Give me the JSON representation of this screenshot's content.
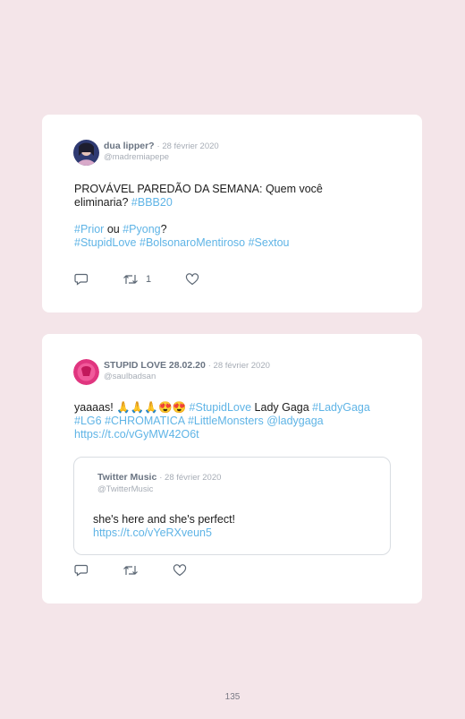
{
  "tweets": [
    {
      "author": "dua lipper?",
      "date": "· 28 février 2020",
      "handle": "@madremiapepe",
      "text_line1": "PROVÁVEL PAREDÃO DA SEMANA: Quem você",
      "text_line2_plain": "eliminaria? ",
      "tag_bbb": "#BBB20",
      "tag_prior": "#Prior",
      "word_ou": " ou ",
      "tag_pyong": "#Pyong",
      "question_mark": "?",
      "tag_stupidlove": "#StupidLove",
      "tag_bolsonaro": "#BolsonaroMentiroso",
      "tag_sextou": "#Sextou",
      "retweet_count": "1"
    },
    {
      "author": "STUPID LOVE 28.02.20",
      "date": "· 28 février 2020",
      "handle": "@saulbadsan",
      "text_start": "yaaaas! 🙏🙏🙏😍😍 ",
      "tag_stupidlove": "#StupidLove",
      "text_mid": " Lady Gaga ",
      "tag_ladygaga": "#LadyGaga",
      "tag_lg6": "#LG6",
      "tag_chromatica": "#CHROMATICA",
      "tag_littlemonsters": "#LittleMonsters",
      "mention_ladygaga": "@ladygaga",
      "link": "https://t.co/vGyMW42O6t",
      "quote": {
        "author": "Twitter Music",
        "date": "· 28 février 2020",
        "handle": "@TwitterMusic",
        "text": "she's here and she's perfect!",
        "link": "https://t.co/vYeRXveun5"
      }
    }
  ],
  "icons": [
    "reply-icon",
    "retweet-icon",
    "like-icon"
  ],
  "colors": {
    "background": "#f4e5e9",
    "link": "#5fb4e6",
    "card": "#ffffff"
  },
  "page_number": "135"
}
